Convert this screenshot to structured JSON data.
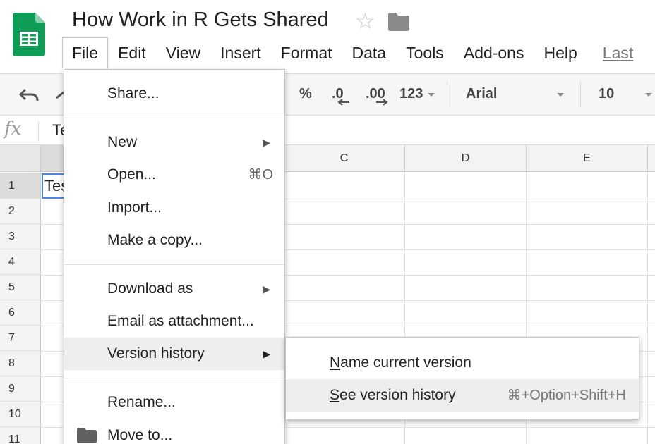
{
  "doc": {
    "title": "How Work in R Gets Shared"
  },
  "colors": {
    "accent": "#4a89dc",
    "sheets_green": "#0f9d58",
    "menu_highlight": "#eeeeee"
  },
  "icons": {
    "logo": "google-sheets-logo",
    "star": "star-outline-icon",
    "folder": "folder-icon",
    "undo": "undo-icon",
    "redo": "redo-icon",
    "fx": "fx-icon"
  },
  "menubar": {
    "items": [
      "File",
      "Edit",
      "View",
      "Insert",
      "Format",
      "Data",
      "Tools",
      "Add-ons",
      "Help"
    ],
    "last_edit": "Last"
  },
  "toolbar": {
    "percent": "%",
    "decrease_decimal": ".0",
    "increase_decimal": ".00",
    "number_format": "123",
    "font": "Arial",
    "font_size": "10"
  },
  "formula_bar": {
    "fx": "fx",
    "value": "Te"
  },
  "grid": {
    "columns": [
      "C",
      "D",
      "E"
    ],
    "rows": [
      "1",
      "2",
      "3",
      "4",
      "5",
      "6",
      "7",
      "8",
      "9",
      "10",
      "11"
    ],
    "cell_a1": "Test"
  },
  "file_menu": {
    "share": "Share...",
    "new": "New",
    "open": "Open...",
    "open_shortcut": "⌘O",
    "import": "Import...",
    "make_copy": "Make a copy...",
    "download_as": "Download as",
    "email_attachment": "Email as attachment...",
    "version_history": "Version history",
    "rename": "Rename...",
    "move_to": "Move to..."
  },
  "version_submenu": {
    "name_current_mnemonic": "N",
    "name_current_rest": "ame current version",
    "see_history_mnemonic": "S",
    "see_history_rest": "ee version history",
    "see_history_shortcut": "⌘+Option+Shift+H"
  }
}
